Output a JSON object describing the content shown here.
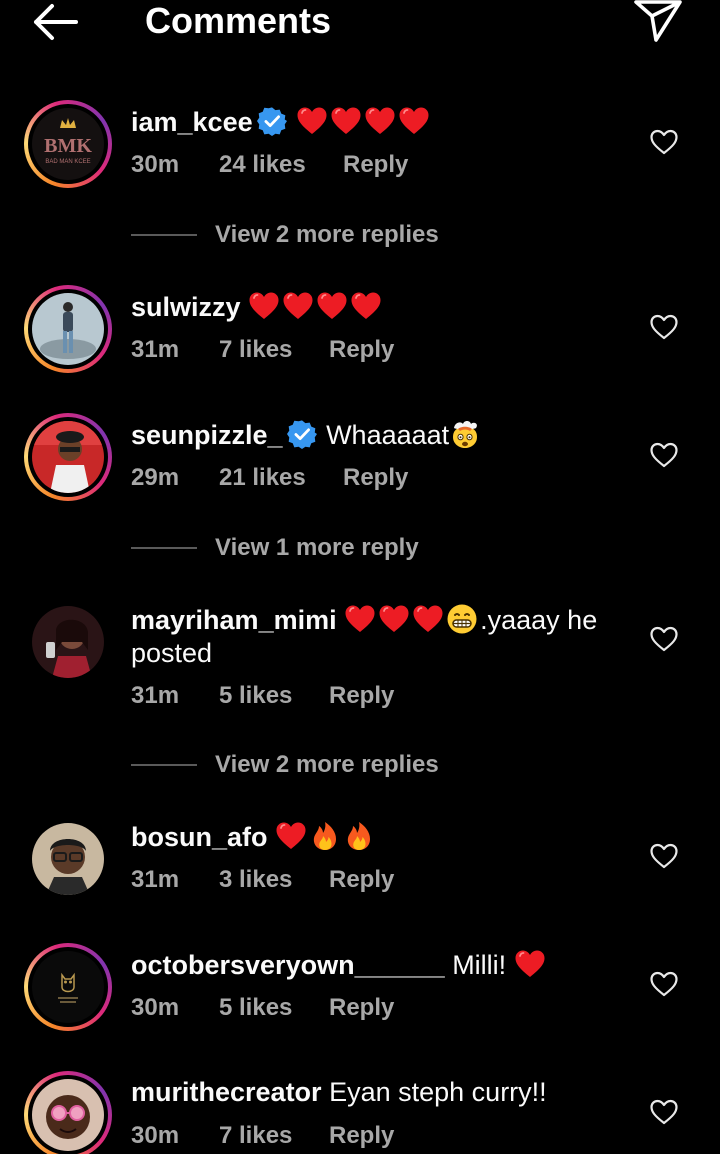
{
  "header": {
    "title": "Comments"
  },
  "comments": [
    {
      "username": "iam_kcee",
      "verified": true,
      "text": "",
      "emojis": [
        "heart",
        "heart",
        "heart",
        "heart"
      ],
      "time": "30m",
      "likes": "24 likes",
      "reply": "Reply",
      "avatar": "bmk-logo"
    },
    {
      "username": "sulwizzy",
      "verified": false,
      "text": "",
      "emojis": [
        "heart",
        "heart",
        "heart",
        "heart"
      ],
      "time": "31m",
      "likes": "7 likes",
      "reply": "Reply",
      "avatar": "person-standing"
    },
    {
      "username": "seunpizzle_",
      "verified": true,
      "text": "Whaaaaat",
      "emojis": [
        "mind-blown"
      ],
      "time": "29m",
      "likes": "21 likes",
      "reply": "Reply",
      "avatar": "person-red"
    },
    {
      "username": "mayriham_mimi",
      "verified": false,
      "text_after": ".yaaay he posted",
      "emojis": [
        "heart",
        "heart",
        "heart",
        "grimace"
      ],
      "time": "31m",
      "likes": "5 likes",
      "reply": "Reply",
      "avatar": "woman-phone"
    },
    {
      "username": "bosun_afo",
      "verified": false,
      "text": "",
      "emojis": [
        "heart",
        "fire",
        "fire"
      ],
      "time": "31m",
      "likes": "3 likes",
      "reply": "Reply",
      "avatar": "man-glasses"
    },
    {
      "username": "octobersveryown______",
      "verified": false,
      "text": "Milli!",
      "emojis": [
        "heart"
      ],
      "time": "30m",
      "likes": "5 likes",
      "reply": "Reply",
      "avatar": "owl-logo"
    },
    {
      "username": "murithecreator",
      "verified": false,
      "text": "Eyan steph curry!!",
      "emojis": [],
      "time": "30m",
      "likes": "7 likes",
      "reply": "Reply",
      "avatar": "man-sunglasses"
    }
  ],
  "more_replies": [
    "View 2 more replies",
    "View 1 more reply",
    "View 2 more replies"
  ],
  "colors": {
    "background": "#000000",
    "heart": "#ed1c24",
    "verified": "#3797f0",
    "muted": "#a8a8a8"
  }
}
